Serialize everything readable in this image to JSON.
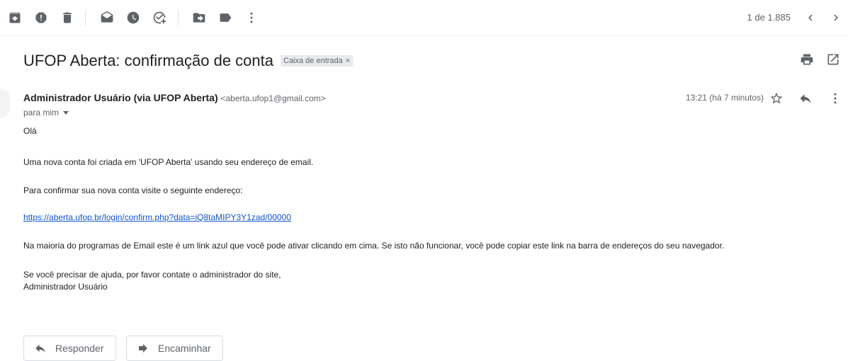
{
  "toolbar": {
    "icons": [
      "archive-icon",
      "report-spam-icon",
      "delete-icon",
      "mark-unread-icon",
      "snooze-icon",
      "add-to-tasks-icon",
      "move-to-icon",
      "labels-icon",
      "more-icon"
    ],
    "pager_text": "1 de 1.885"
  },
  "message": {
    "subject": "UFOP Aberta: confirmação de conta",
    "label": "Caixa de entrada",
    "label_remove": "×",
    "sender_name": "Administrador Usuário (via UFOP Aberta)",
    "sender_email": "<aberta.ufop1@gmail.com>",
    "to": "para mim",
    "time": "13:21 (há 7 minutos)"
  },
  "body": {
    "greeting": "Olá",
    "line1": "Uma nova conta foi criada em 'UFOP Aberta' usando seu endereço de email.",
    "line2": "Para confirmar sua nova conta visite o seguinte endereço:",
    "link": "https://aberta.ufop.br/login/confirm.php?data=iQ8taMIPY3Y1zad/00000",
    "line3": "Na maioria do programas de Email este é um link azul que você pode ativar clicando em cima. Se isto não funcionar, você pode copiar este link na barra de endereços do seu navegador.",
    "line4": "Se você precisar de ajuda, por favor contate o administrador do site,",
    "signature": "Administrador Usuário"
  },
  "actions": {
    "reply": "Responder",
    "forward": "Encaminhar"
  }
}
